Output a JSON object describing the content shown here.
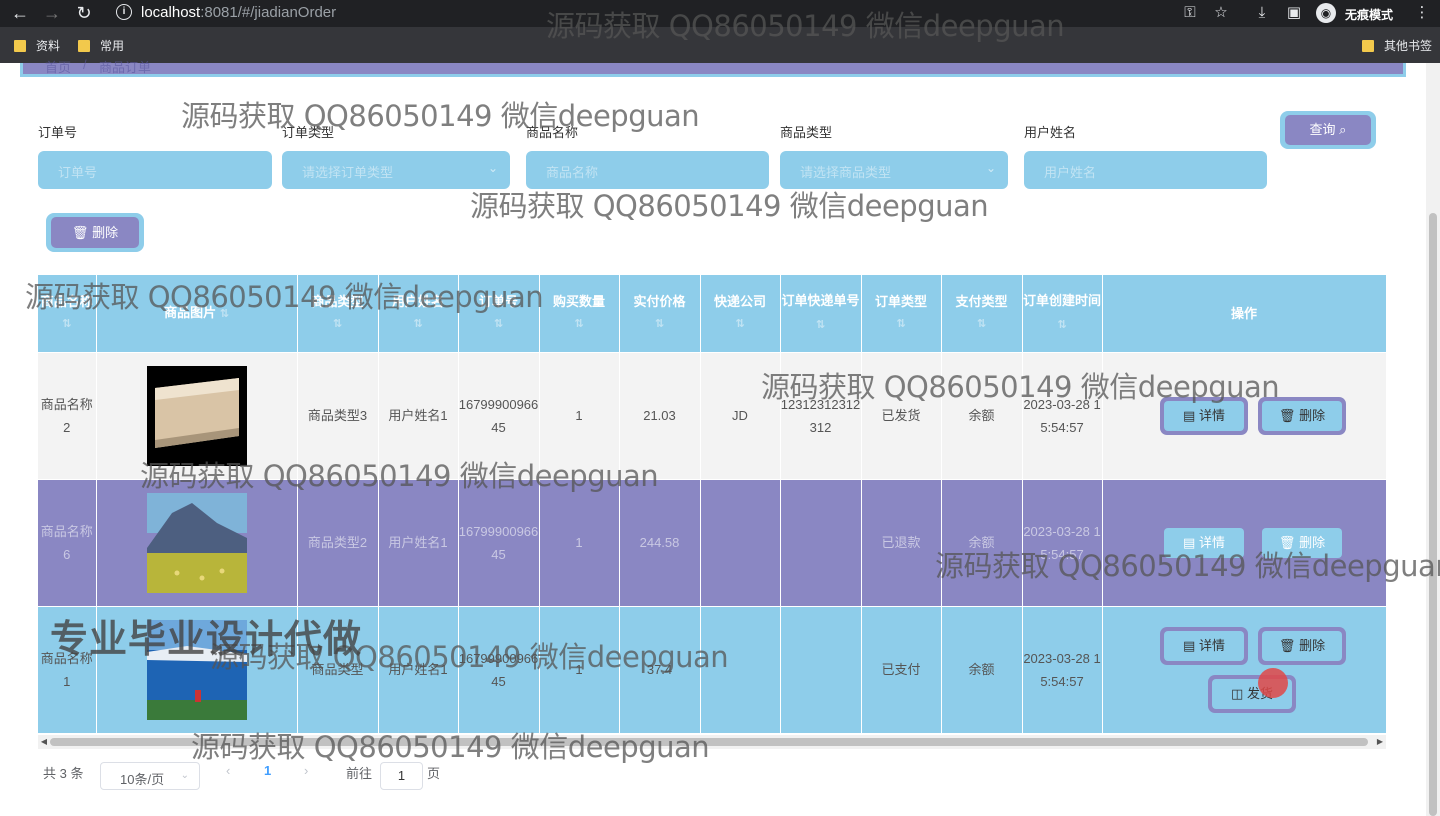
{
  "browser": {
    "url_host": "localhost",
    "url_rest": ":8081/#/jiadianOrder",
    "incognito_label": "无痕模式",
    "bookmarks": [
      "资料",
      "常用"
    ],
    "other_bookmarks": "其他书签"
  },
  "breadcrumb": {
    "home": "首页",
    "current": "商品订单"
  },
  "search": {
    "fields": [
      {
        "label": "订单号",
        "placeholder": "订单号"
      },
      {
        "label": "订单类型",
        "placeholder": "请选择订单类型"
      },
      {
        "label": "商品名称",
        "placeholder": "商品名称"
      },
      {
        "label": "商品类型",
        "placeholder": "请选择商品类型"
      },
      {
        "label": "用户姓名",
        "placeholder": "用户姓名"
      }
    ],
    "query_label": "查询",
    "delete_label": "删除"
  },
  "table": {
    "headers": [
      "商品名称",
      "商品图片",
      "商品类型",
      "用户姓名",
      "订单号",
      "购买数量",
      "实付价格",
      "快递公司",
      "订单快递单号",
      "订单类型",
      "支付类型",
      "订单创建时间",
      "操作"
    ],
    "rows": [
      {
        "name": "商品名称2",
        "type": "商品类型3",
        "user": "用户姓名1",
        "order_no": "1679990096645",
        "qty": "1",
        "price": "21.03",
        "express": "JD",
        "express_no": "12312312312312",
        "order_type": "已发货",
        "pay_type": "余额",
        "created": "2023-03-28 15:54:57"
      },
      {
        "name": "商品名称6",
        "type": "商品类型2",
        "user": "用户姓名1",
        "order_no": "1679990096645",
        "qty": "1",
        "price": "244.58",
        "express": "",
        "express_no": "",
        "order_type": "已退款",
        "pay_type": "余额",
        "created": "2023-03-28 15:54:57"
      },
      {
        "name": "商品名称1",
        "type": "商品类型",
        "user": "用户姓名1",
        "order_no": "1679990096645",
        "qty": "1",
        "price": "37.4",
        "express": "",
        "express_no": "",
        "order_type": "已支付",
        "pay_type": "余额",
        "created": "2023-03-28 15:54:57"
      }
    ],
    "detail_label": "详情",
    "delete_label": "删除",
    "ship_label": "发货"
  },
  "pagination": {
    "total": "共 3 条",
    "page_size": "10条/页",
    "current": "1",
    "goto": "前往",
    "goto_value": "1",
    "page_unit": "页"
  },
  "overlay": {
    "watermark": "源码获取 QQ86050149 微信deepguan",
    "promo": "专业毕业设计代做"
  }
}
